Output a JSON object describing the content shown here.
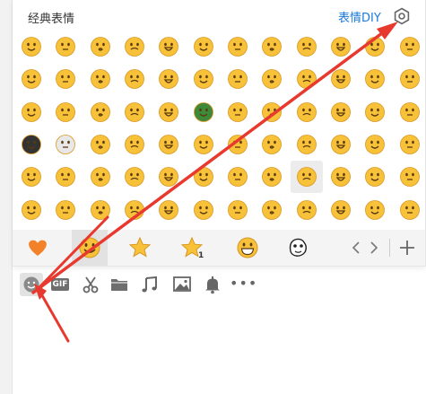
{
  "panel": {
    "title": "经典表情",
    "diy_label": "表情DIY"
  },
  "emoji_grid": {
    "rows": 6,
    "columns": 12,
    "selected_cell": 56
  },
  "category_tabs": [
    {
      "name": "favorites",
      "icon": "heart-icon",
      "active": false
    },
    {
      "name": "classic",
      "icon": "smiley-icon",
      "active": true
    },
    {
      "name": "star",
      "icon": "star-icon",
      "active": false
    },
    {
      "name": "star-1",
      "icon": "star-one-icon",
      "badge": "1",
      "active": false
    },
    {
      "name": "grin",
      "icon": "grin-icon",
      "active": false
    },
    {
      "name": "sticker",
      "icon": "sticker-face-icon",
      "active": false
    }
  ],
  "category_nav": {
    "prev": "chevron-left-icon",
    "next": "chevron-right-icon",
    "add": "plus-icon"
  },
  "toolbar": {
    "gif_label": "GIF",
    "more_label": "•••",
    "items": [
      "emoji-icon",
      "gif-icon",
      "scissors-icon",
      "folder-icon",
      "music-icon",
      "image-icon",
      "bell-icon",
      "more-icon"
    ]
  },
  "colors": {
    "emoji_face": "#f7c23a",
    "emoji_outline": "#d9961f",
    "heart": "#f2812a",
    "link": "#1a7ad9",
    "arrow": "#e8392f"
  }
}
